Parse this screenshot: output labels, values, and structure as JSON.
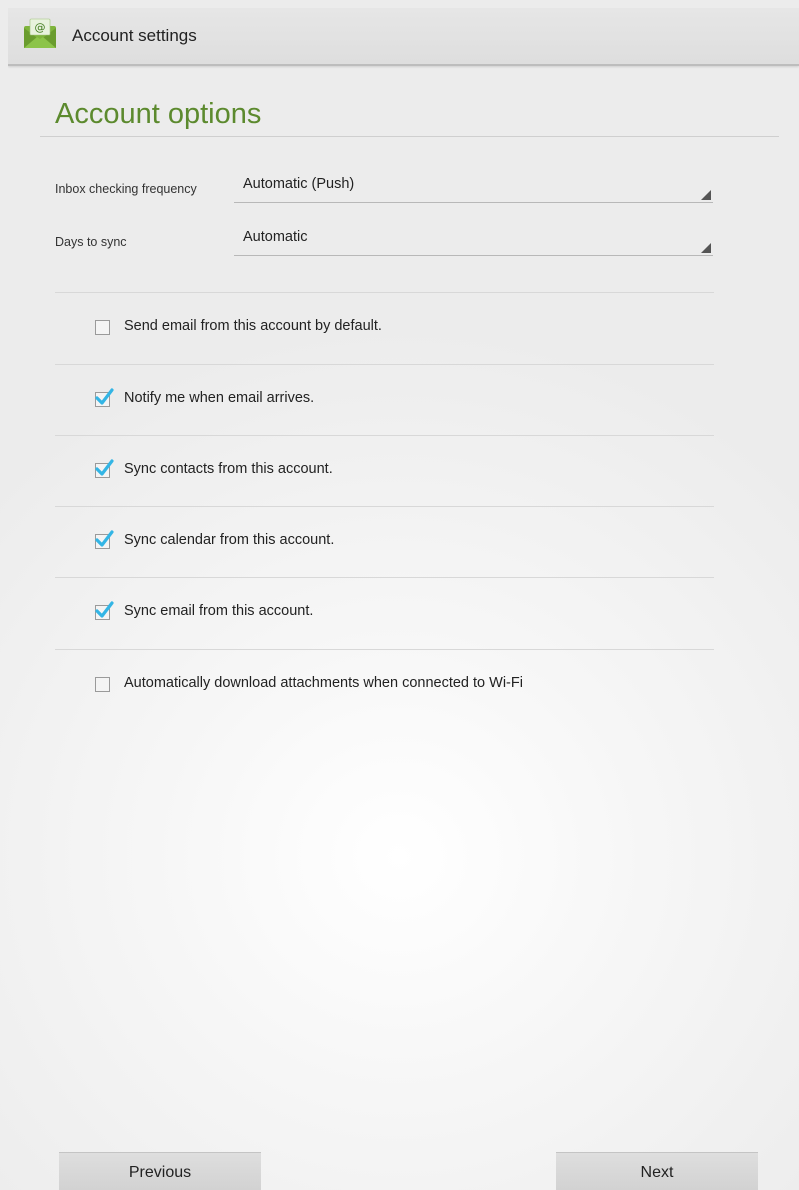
{
  "action_bar": {
    "title": "Account settings",
    "icon": "email-app-icon"
  },
  "section": {
    "heading": "Account options"
  },
  "settings": {
    "inbox_frequency": {
      "label": "Inbox checking frequency",
      "value": "Automatic (Push)"
    },
    "days_to_sync": {
      "label": "Days to sync",
      "value": "Automatic"
    }
  },
  "checkboxes": [
    {
      "label": "Send email from this account by default.",
      "checked": false
    },
    {
      "label": "Notify me when email arrives.",
      "checked": true
    },
    {
      "label": "Sync contacts from this account.",
      "checked": true
    },
    {
      "label": "Sync calendar from this account.",
      "checked": true
    },
    {
      "label": "Sync email from this account.",
      "checked": true
    },
    {
      "label": "Automatically download attachments when connected to Wi-Fi",
      "checked": false
    }
  ],
  "buttons": {
    "previous": "Previous",
    "next": "Next"
  },
  "colors": {
    "heading": "#5c8a2e",
    "check_accent": "#33b5e5"
  }
}
